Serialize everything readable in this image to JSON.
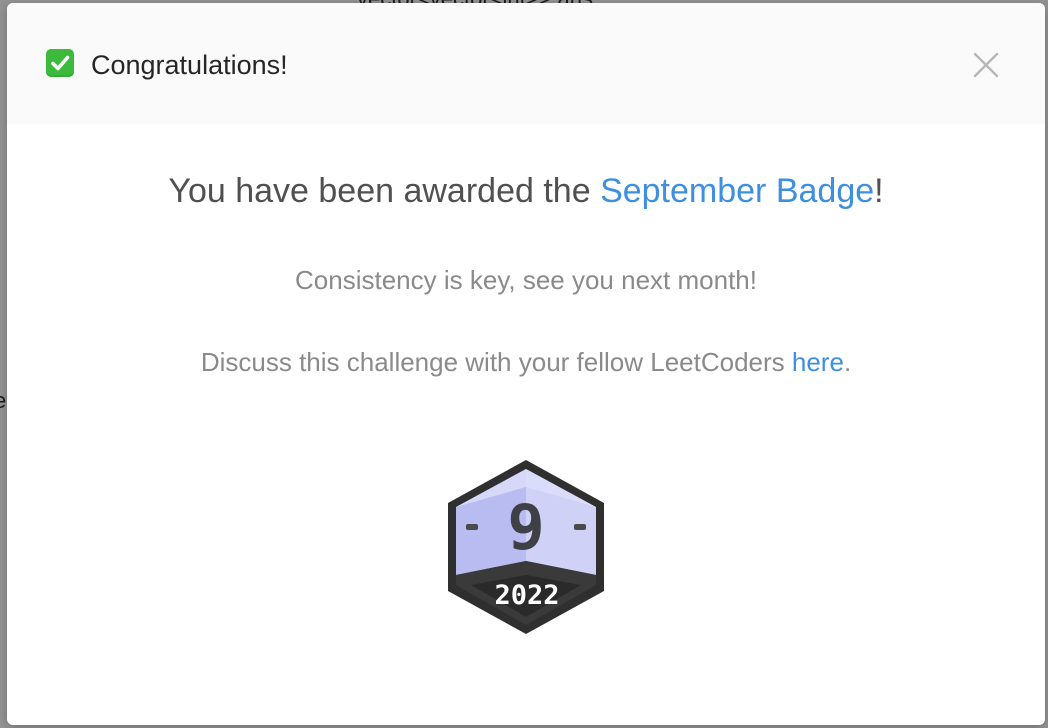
{
  "background": {
    "fragments": [
      "vector<vector<int>> ans",
      "e"
    ]
  },
  "dialog": {
    "title": "Congratulations!",
    "title_icon": "check-mark-icon",
    "close_icon": "close-icon"
  },
  "body": {
    "award_prefix": "You have been awarded the ",
    "award_link": "September Badge",
    "award_suffix": "!",
    "consistency": "Consistency is key, see you next month!",
    "discuss_prefix": "Discuss this challenge with your fellow LeetCoders ",
    "discuss_link": "here",
    "discuss_suffix": "."
  },
  "badge": {
    "number": "9",
    "year": "2022"
  },
  "colors": {
    "link": "#3f8fdf",
    "check": "#3cba3c",
    "badge_light": "#c4c7f4",
    "badge_dark": "#2e2e2e"
  }
}
